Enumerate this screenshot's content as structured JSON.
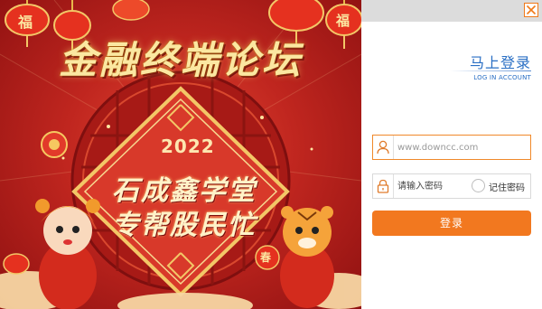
{
  "banner": {
    "title": "金融终端论坛",
    "year": "2022",
    "slogan_line1": "石成鑫学堂",
    "slogan_line2": "专帮股民忙",
    "decor_text": "福",
    "lantern_text": "春"
  },
  "login": {
    "title": "马上登录",
    "subtitle": "LOG IN ACCOUNT",
    "username": {
      "placeholder": "www.downcc.com",
      "value": ""
    },
    "password": {
      "placeholder": "请输入密码",
      "value": ""
    },
    "remember_label": "记住密码",
    "submit_label": "登录"
  },
  "colors": {
    "accent": "#f2781f",
    "title_blue": "#2a6fc4",
    "banner_red": "#c0261f",
    "gold": "#f3c767"
  },
  "icons": [
    "close-icon",
    "user-icon",
    "lock-icon",
    "radio-icon"
  ]
}
